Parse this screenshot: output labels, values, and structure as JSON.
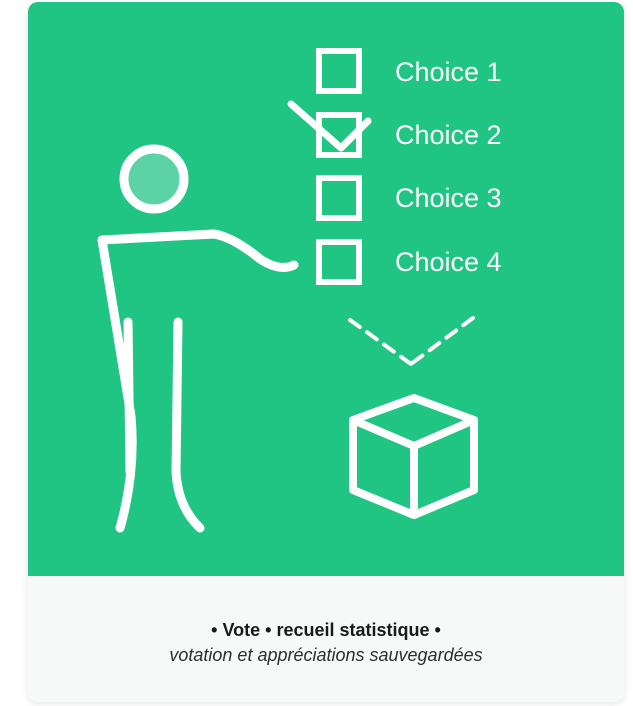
{
  "card": {
    "background_color": "#20c483",
    "illustration": {
      "figure_icon": "person-icon",
      "box_icon": "cube-icon",
      "choices": [
        {
          "label": "Choice 1",
          "checked": false
        },
        {
          "label": "Choice 2",
          "checked": true
        },
        {
          "label": "Choice 3",
          "checked": false
        },
        {
          "label": "Choice 4",
          "checked": false
        }
      ]
    },
    "caption": {
      "title": "• Vote • recueil statistique •",
      "subtitle": "votation et appréciations sauvegardées"
    }
  }
}
